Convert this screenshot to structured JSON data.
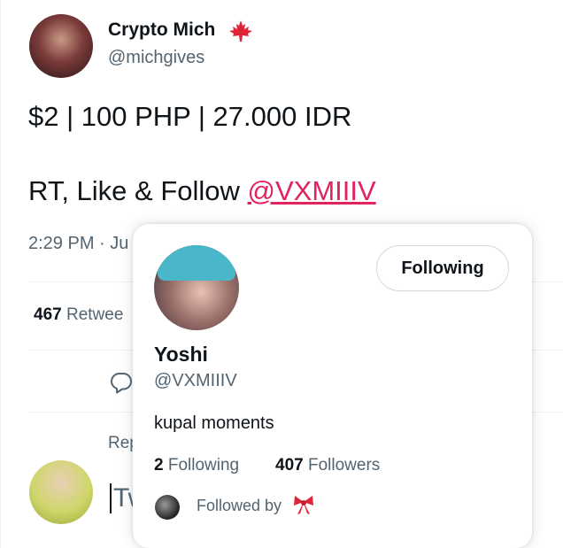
{
  "tweet": {
    "author": {
      "name": "Crypto Mich",
      "handle": "@michgives",
      "badge_icon": "maple-leaf-icon"
    },
    "line1": "$2 | 100 PHP | 27.000 IDR",
    "line2_prefix": "RT, Like & Follow ",
    "mention": "@VXMIIIV",
    "timestamp": "2:29 PM · Ju",
    "retweets_count": "467",
    "retweets_label": "Retwee",
    "reply_prompt": "Rep",
    "compose_placeholder": "Tw"
  },
  "hovercard": {
    "name": "Yoshi",
    "handle": "@VXMIIIV",
    "bio": "kupal moments",
    "follow_button": "Following",
    "following_count": "2",
    "following_label": "Following",
    "followers_count": "407",
    "followers_label": "Followers",
    "followed_by_label": "Followed by"
  },
  "colors": {
    "mention": "#e0245e",
    "text": "#0f1419",
    "muted": "#536471",
    "maple": "#e0253a"
  }
}
